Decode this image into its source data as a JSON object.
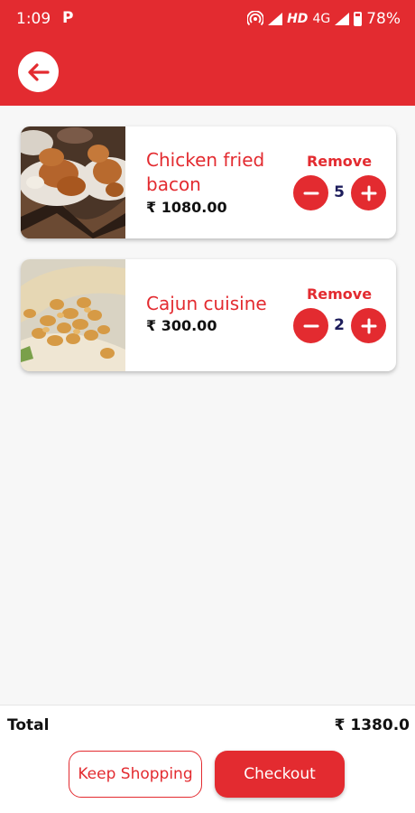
{
  "status_bar": {
    "time": "1:09",
    "app_icon": "P",
    "network_hd": "HD",
    "network_type": "4G",
    "battery": "78%"
  },
  "header": {
    "back_icon": "arrow-left-icon"
  },
  "cart": {
    "items": [
      {
        "name": "Chicken fried bacon",
        "price": "₹ 1080.00",
        "remove_label": "Remove",
        "quantity": "5",
        "image": "fried chicken plates"
      },
      {
        "name": "Cajun cuisine",
        "price": "₹ 300.00",
        "remove_label": "Remove",
        "quantity": "2",
        "image": "cajun shrimp wrap"
      }
    ]
  },
  "footer": {
    "total_label": "Total",
    "total_value": "₹ 1380.0",
    "keep_shopping_label": "Keep Shopping",
    "checkout_label": "Checkout"
  },
  "colors": {
    "accent": "#e32b30",
    "quantity_text": "#1d1d5c",
    "background": "#f7f7f7"
  }
}
